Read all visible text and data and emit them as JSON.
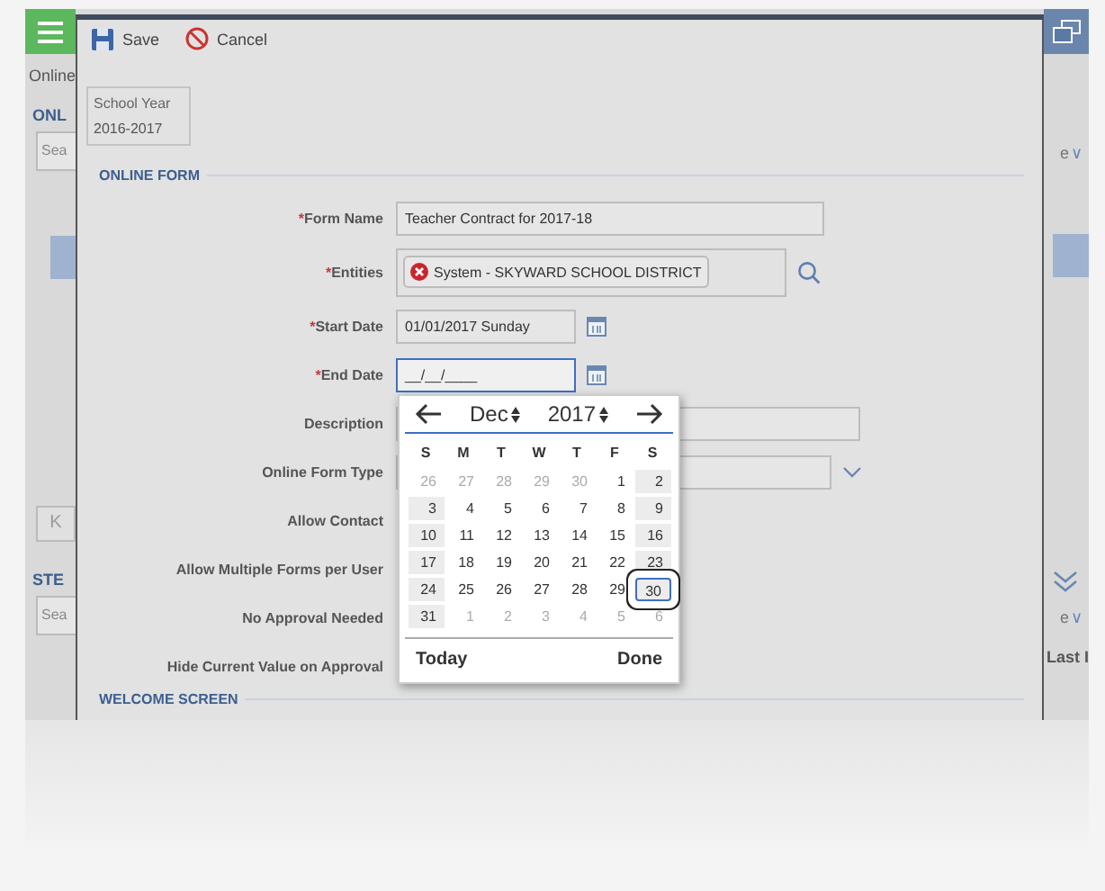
{
  "background_app": {
    "left_texts": [
      {
        "kind": "crumb",
        "text": "Online"
      },
      {
        "kind": "heading",
        "text": "ONL"
      },
      {
        "kind": "field",
        "text": "Sea"
      },
      {
        "kind": "row"
      },
      {
        "kind": "button",
        "text": "K"
      },
      {
        "kind": "heading",
        "text": "STE"
      },
      {
        "kind": "field",
        "text": "Sea"
      }
    ],
    "right_texts": [
      {
        "kind": "dropdown",
        "text": "e",
        "chevron": "∨"
      },
      {
        "kind": "row"
      },
      {
        "kind": "dropdown",
        "text": "e",
        "chevron": "∨"
      },
      {
        "kind": "column",
        "text": "Last I"
      }
    ]
  },
  "toolbar": [
    {
      "kind": "save",
      "label": "Save"
    },
    {
      "kind": "cancel",
      "label": "Cancel"
    }
  ],
  "school_year": {
    "label": "School Year",
    "value": "2016-2017"
  },
  "section": "ONLINE FORM",
  "required_mark": "*",
  "fields": [
    {
      "kind": "text",
      "label": "Form Name",
      "required": true,
      "value": "Teacher Contract for 2017-18"
    },
    {
      "kind": "entities",
      "label": "Entities",
      "required": true,
      "value": "System - SKYWARD SCHOOL DISTRICT"
    },
    {
      "kind": "date",
      "label": "Start Date",
      "required": true,
      "value": "01/01/2017 Sunday",
      "focused": false
    },
    {
      "kind": "date",
      "label": "End Date",
      "required": true,
      "value": "__/__/____",
      "focused": true
    },
    {
      "kind": "wide",
      "label": "Description",
      "required": false
    },
    {
      "kind": "select",
      "label": "Online Form Type",
      "required": false
    },
    {
      "kind": "none",
      "label": "Allow Contact",
      "required": false
    },
    {
      "kind": "none",
      "label": "Allow Multiple Forms per User",
      "required": false
    },
    {
      "kind": "none",
      "label": "No Approval Needed",
      "required": false
    },
    {
      "kind": "none",
      "label": "Hide Current Value on Approval",
      "required": false
    }
  ],
  "calendar": {
    "month": "Dec",
    "year": "2017",
    "weekdays": [
      "S",
      "M",
      "T",
      "W",
      "T",
      "F",
      "S"
    ],
    "weeks": [
      [
        {
          "day": "26",
          "outside": true,
          "selected": false
        },
        {
          "day": "27",
          "outside": true,
          "selected": false
        },
        {
          "day": "28",
          "outside": true,
          "selected": false
        },
        {
          "day": "29",
          "outside": true,
          "selected": false
        },
        {
          "day": "30",
          "outside": true,
          "selected": false
        },
        {
          "day": "1",
          "outside": false,
          "selected": false
        },
        {
          "day": "2",
          "outside": false,
          "selected": false
        }
      ],
      [
        {
          "day": "3",
          "outside": false,
          "selected": false
        },
        {
          "day": "4",
          "outside": false,
          "selected": false
        },
        {
          "day": "5",
          "outside": false,
          "selected": false
        },
        {
          "day": "6",
          "outside": false,
          "selected": false
        },
        {
          "day": "7",
          "outside": false,
          "selected": false
        },
        {
          "day": "8",
          "outside": false,
          "selected": false
        },
        {
          "day": "9",
          "outside": false,
          "selected": false
        }
      ],
      [
        {
          "day": "10",
          "outside": false,
          "selected": false
        },
        {
          "day": "11",
          "outside": false,
          "selected": false
        },
        {
          "day": "12",
          "outside": false,
          "selected": false
        },
        {
          "day": "13",
          "outside": false,
          "selected": false
        },
        {
          "day": "14",
          "outside": false,
          "selected": false
        },
        {
          "day": "15",
          "outside": false,
          "selected": false
        },
        {
          "day": "16",
          "outside": false,
          "selected": false
        }
      ],
      [
        {
          "day": "17",
          "outside": false,
          "selected": false
        },
        {
          "day": "18",
          "outside": false,
          "selected": false
        },
        {
          "day": "19",
          "outside": false,
          "selected": false
        },
        {
          "day": "20",
          "outside": false,
          "selected": false
        },
        {
          "day": "21",
          "outside": false,
          "selected": false
        },
        {
          "day": "22",
          "outside": false,
          "selected": false
        },
        {
          "day": "23",
          "outside": false,
          "selected": false
        }
      ],
      [
        {
          "day": "24",
          "outside": false,
          "selected": false
        },
        {
          "day": "25",
          "outside": false,
          "selected": false
        },
        {
          "day": "26",
          "outside": false,
          "selected": false
        },
        {
          "day": "27",
          "outside": false,
          "selected": false
        },
        {
          "day": "28",
          "outside": false,
          "selected": false
        },
        {
          "day": "29",
          "outside": false,
          "selected": false
        },
        {
          "day": "30",
          "outside": false,
          "selected": true
        }
      ],
      [
        {
          "day": "31",
          "outside": false,
          "selected": false
        },
        {
          "day": "1",
          "outside": true,
          "selected": false
        },
        {
          "day": "2",
          "outside": true,
          "selected": false
        },
        {
          "day": "3",
          "outside": true,
          "selected": false
        },
        {
          "day": "4",
          "outside": true,
          "selected": false
        },
        {
          "day": "5",
          "outside": true,
          "selected": false
        },
        {
          "day": "6",
          "outside": true,
          "selected": false
        }
      ]
    ],
    "today": "Today",
    "done": "Done"
  },
  "section_2": "WELCOME SCREEN"
}
